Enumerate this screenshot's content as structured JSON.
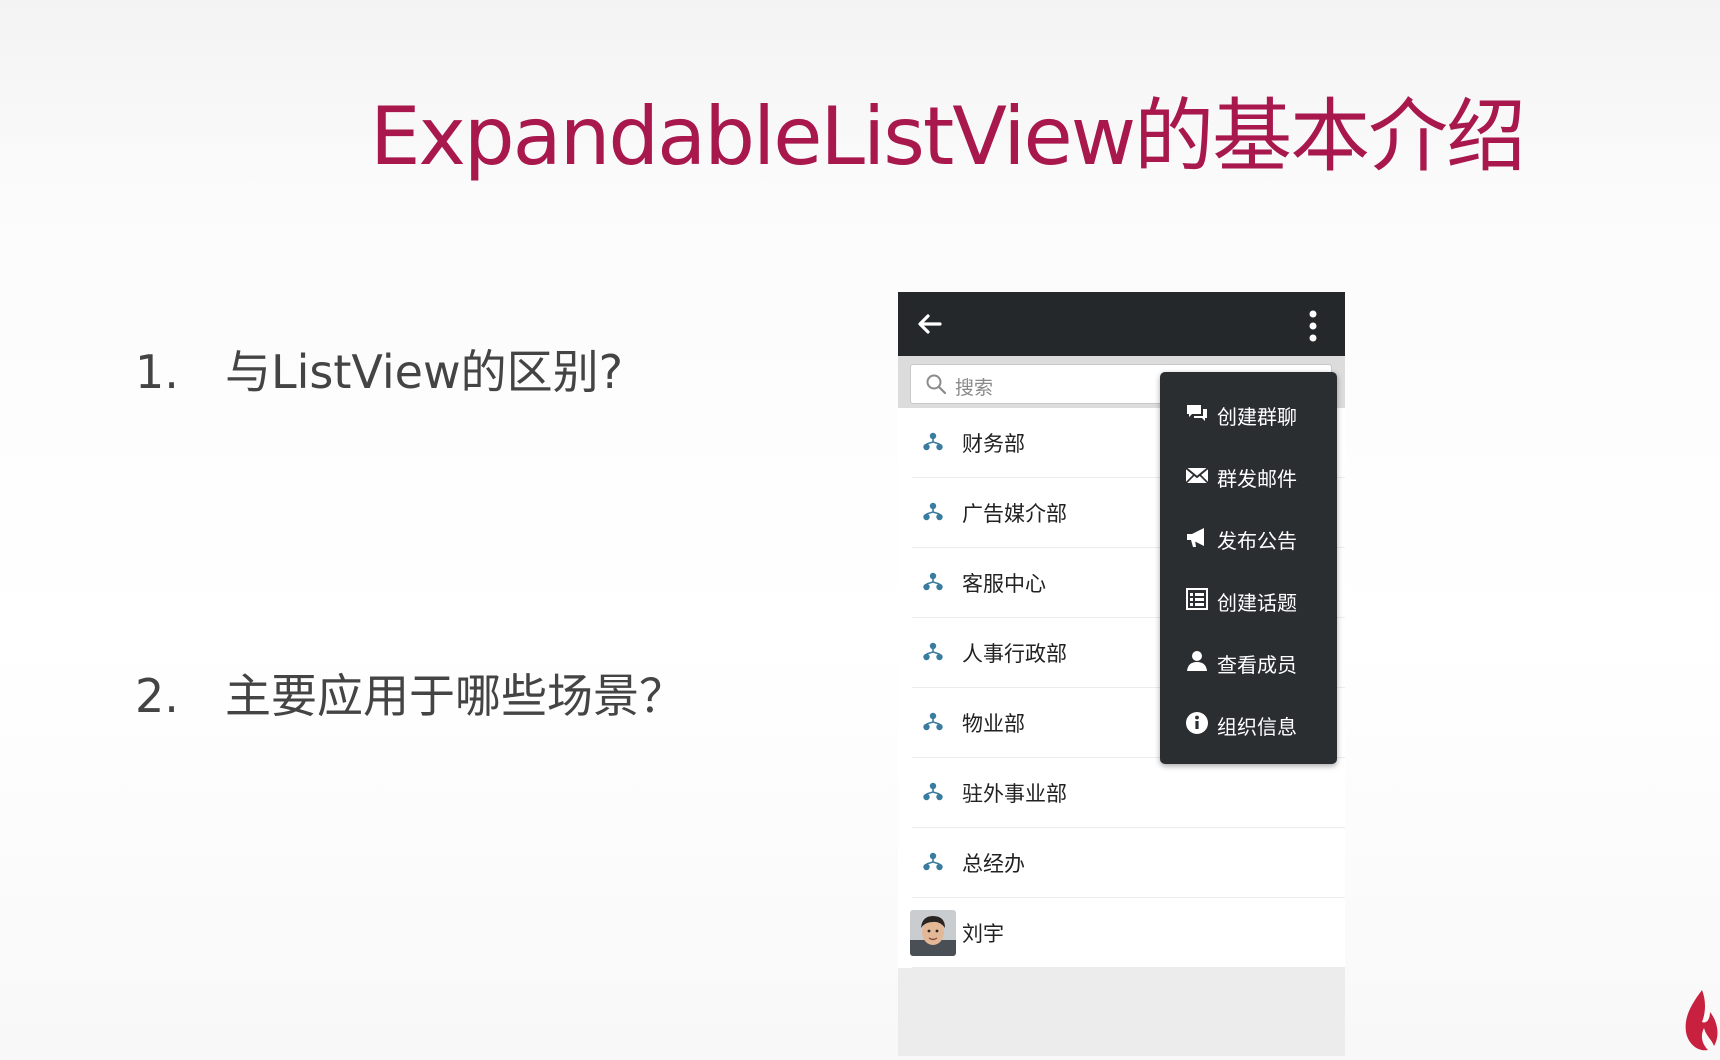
{
  "slide": {
    "title": "ExpandableListView的基本介绍",
    "questions": [
      {
        "number": "1.",
        "text": "与ListView的区别?"
      },
      {
        "number": "2.",
        "text": "主要应用于哪些场景？"
      }
    ]
  },
  "phone": {
    "actionbar": {
      "back_icon": "arrow-left-icon",
      "more_icon": "more-vertical-icon"
    },
    "search": {
      "placeholder": "搜索",
      "icon": "search-icon"
    },
    "list_items": [
      {
        "label": "财务部",
        "icon": "org-icon"
      },
      {
        "label": "广告媒介部",
        "icon": "org-icon"
      },
      {
        "label": "客服中心",
        "icon": "org-icon"
      },
      {
        "label": "人事行政部",
        "icon": "org-icon"
      },
      {
        "label": "物业部",
        "icon": "org-icon"
      },
      {
        "label": "驻外事业部",
        "icon": "org-icon"
      },
      {
        "label": "总经办",
        "icon": "org-icon"
      },
      {
        "label": "刘宇",
        "icon": "avatar"
      }
    ],
    "menu": [
      {
        "label": "创建群聊",
        "icon": "chat-bubbles-icon"
      },
      {
        "label": "群发邮件",
        "icon": "mail-icon"
      },
      {
        "label": "发布公告",
        "icon": "megaphone-icon"
      },
      {
        "label": "创建话题",
        "icon": "list-icon"
      },
      {
        "label": "查看成员",
        "icon": "person-icon"
      },
      {
        "label": "组织信息",
        "icon": "info-icon"
      }
    ]
  },
  "colors": {
    "title": "#a8184c",
    "actionbar": "#24282b",
    "menu_bg": "#2a2e31",
    "org_icon": "#3a7ca0",
    "logo": "#c8213f"
  }
}
